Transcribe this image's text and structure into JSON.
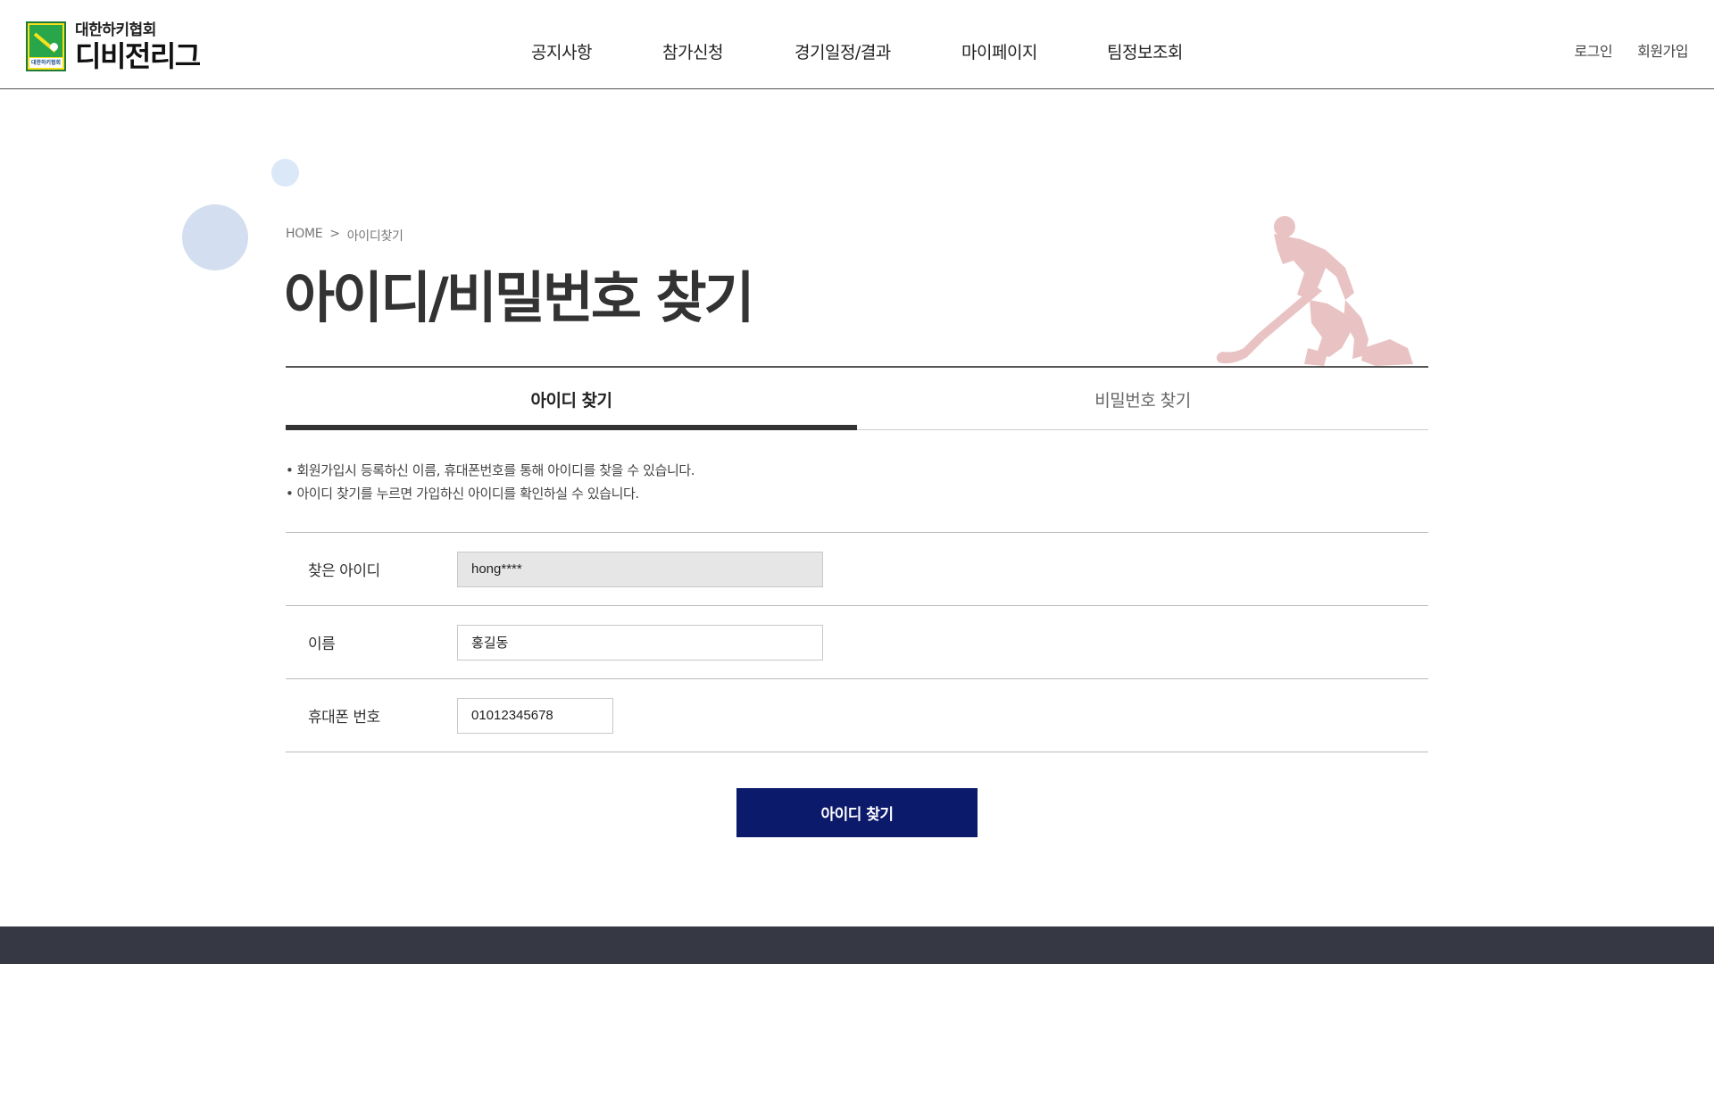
{
  "header": {
    "logo": {
      "org": "대한하키협회",
      "league": "디비전리그",
      "emblem_caption": "대한하키협회"
    },
    "nav": [
      {
        "label": "공지사항"
      },
      {
        "label": "참가신청"
      },
      {
        "label": "경기일정/결과"
      },
      {
        "label": "마이페이지"
      },
      {
        "label": "팀정보조회"
      }
    ],
    "util": {
      "login": "로그인",
      "signup": "회원가입"
    }
  },
  "breadcrumb": {
    "home": "HOME",
    "separator": ">",
    "current": "아이디찾기"
  },
  "page_title": "아이디/비밀번호 찾기",
  "tabs": [
    {
      "label": "아이디 찾기",
      "active": true
    },
    {
      "label": "비밀번호 찾기",
      "active": false
    }
  ],
  "notes": [
    "회원가입시 등록하신 이름, 휴대폰번호를 통해 아이디를 찾을 수 있습니다.",
    "아이디 찾기를 누르면 가입하신 아이디를 확인하실 수 있습니다."
  ],
  "form": {
    "found_id": {
      "label": "찾은 아이디",
      "value": "hong****"
    },
    "name": {
      "label": "이름",
      "value": "홍길동"
    },
    "phone": {
      "label": "휴대폰 번호",
      "value": "01012345678"
    }
  },
  "submit_label": "아이디 찾기",
  "colors": {
    "primary_button": "#0c1a6b",
    "footer": "#363843",
    "accent_circle": "#d3dff0",
    "player_silhouette": "#e9c3c3"
  },
  "icons": {
    "logo": "hockey-emblem-icon",
    "decoration": "hockey-player-icon"
  }
}
